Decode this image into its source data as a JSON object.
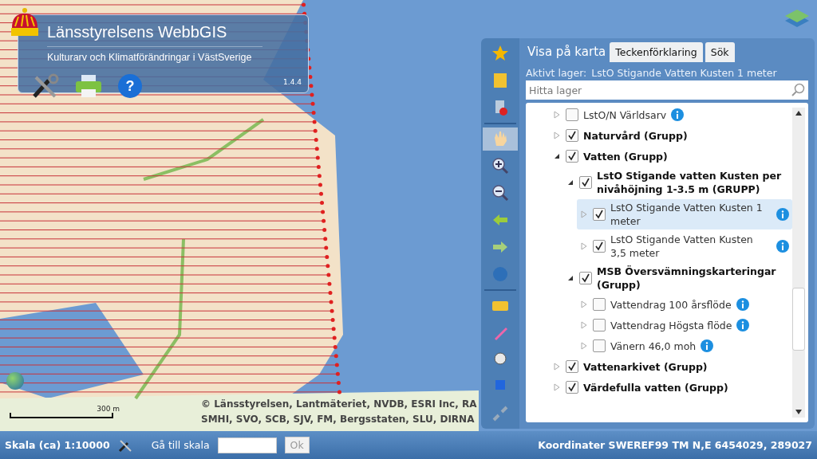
{
  "header": {
    "title": "Länsstyrelsens WebbGIS",
    "subtitle": "Kulturarv och Klimatförändringar i VästSverige",
    "version": "1.4.4",
    "help_glyph": "?"
  },
  "map": {
    "attribution_lines": [
      "© Länsstyrelsen, Lantmäteriet, NVDB, ESRI Inc, RA",
      "SMHI, SVO, SCB, SJV, FM, Bergsstaten, SLU, DIRNA"
    ],
    "scale_bar": "300 m"
  },
  "tabs": [
    {
      "label": "Visa på karta",
      "selected": true
    },
    {
      "label": "Teckenförklaring",
      "selected": false
    },
    {
      "label": "Sök",
      "selected": false
    }
  ],
  "active_layer": {
    "label": "Aktivt lager:",
    "value": "LstO Stigande Vatten Kusten 1 meter"
  },
  "search": {
    "placeholder": "Hitta lager"
  },
  "tree": {
    "items": [
      {
        "label": "LstO/N Världsarv",
        "kind": "layer",
        "checked": false,
        "expanded": false,
        "selected": false,
        "info": true
      },
      {
        "label": "Naturvård (Grupp)",
        "kind": "group",
        "checked": true,
        "expanded": false,
        "selected": false,
        "info": false
      },
      {
        "label": "Vatten (Grupp)",
        "kind": "group",
        "checked": true,
        "expanded": true,
        "selected": false,
        "info": false,
        "children": [
          {
            "label": "LstO Stigande vatten Kusten per nivåhöjning 1-3.5 m (GRUPP)",
            "kind": "group",
            "checked": true,
            "expanded": true,
            "selected": false,
            "info": false,
            "children": [
              {
                "label": "LstO Stigande Vatten Kusten 1 meter",
                "kind": "layer",
                "checked": true,
                "expanded": false,
                "selected": true,
                "info": true
              },
              {
                "label": "LstO Stigande Vatten Kusten 3,5 meter",
                "kind": "layer",
                "checked": true,
                "expanded": false,
                "selected": false,
                "info": true
              }
            ]
          },
          {
            "label": "MSB Översvämningskarteringar (Grupp)",
            "kind": "group",
            "checked": true,
            "expanded": true,
            "selected": false,
            "info": false,
            "children": [
              {
                "label": "Vattendrag 100 årsflöde",
                "kind": "layer",
                "checked": false,
                "expanded": false,
                "selected": false,
                "info": true
              },
              {
                "label": "Vattendrag Högsta flöde",
                "kind": "layer",
                "checked": false,
                "expanded": false,
                "selected": false,
                "info": true
              },
              {
                "label": "Vänern 46,0 moh",
                "kind": "layer",
                "checked": false,
                "expanded": false,
                "selected": false,
                "info": true
              }
            ]
          }
        ]
      },
      {
        "label": "Vattenarkivet (Grupp)",
        "kind": "group",
        "checked": true,
        "expanded": false,
        "selected": false,
        "info": false
      },
      {
        "label": "Värdefulla vatten (Grupp)",
        "kind": "group",
        "checked": true,
        "expanded": false,
        "selected": false,
        "info": false
      }
    ]
  },
  "status_bar": {
    "scale": "Skala (ca) 1:10000",
    "goto_label": "Gå till skala",
    "ok_button": "Ok",
    "coordinates": "Koordinater SWEREF99 TM N,E 6454029, 289027"
  }
}
